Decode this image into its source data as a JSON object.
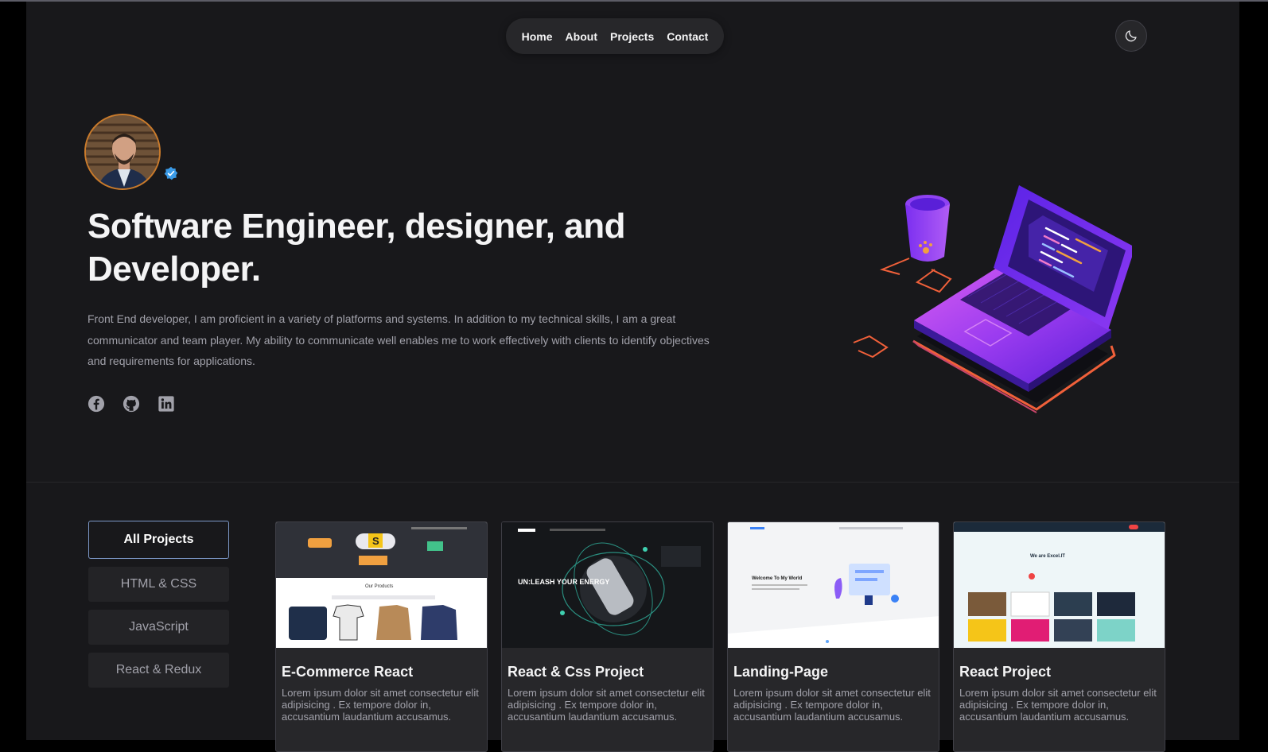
{
  "nav": {
    "items": [
      "Home",
      "About",
      "Projects",
      "Contact"
    ]
  },
  "theme_toggle": {
    "icon": "moon-icon"
  },
  "hero": {
    "title": "Software Engineer, designer, and Developer.",
    "description": "Front End developer, I am proficient in a variety of platforms and systems. In addition to my technical skills, I am a great communicator and team player. My ability to communicate well enables me to work effectively with clients to identify objectives and requirements for applications.",
    "socials": [
      "facebook-icon",
      "github-icon",
      "linkedin-icon"
    ]
  },
  "filters": [
    "All Projects",
    "HTML & CSS",
    "JavaScript",
    "React & Redux"
  ],
  "cards": [
    {
      "title": "E-Commerce React",
      "body": "Lorem ipsum dolor sit amet consectetur elit adipisicing . Ex tempore dolor in, accusantium laudantium accusamus.",
      "thumb_text": "Our Products"
    },
    {
      "title": "React & Css Project",
      "body": "Lorem ipsum dolor sit amet consectetur elit adipisicing . Ex tempore dolor in, accusantium laudantium accusamus.",
      "thumb_text": "UN:LEASH YOUR ENERGY"
    },
    {
      "title": "Landing-Page",
      "body": "Lorem ipsum dolor sit amet consectetur elit adipisicing . Ex tempore dolor in, accusantium laudantium accusamus.",
      "thumb_text": "Welcome To My World"
    },
    {
      "title": "React Project",
      "body": "Lorem ipsum dolor sit amet consectetur elit adipisicing . Ex tempore dolor in, accusantium laudantium accusamus.",
      "thumb_text": "We are Excel.IT"
    }
  ],
  "colors": {
    "background": "#18181b",
    "surface": "#27272a",
    "accent_border": "#7c98c8",
    "verified": "#3b9be8"
  }
}
